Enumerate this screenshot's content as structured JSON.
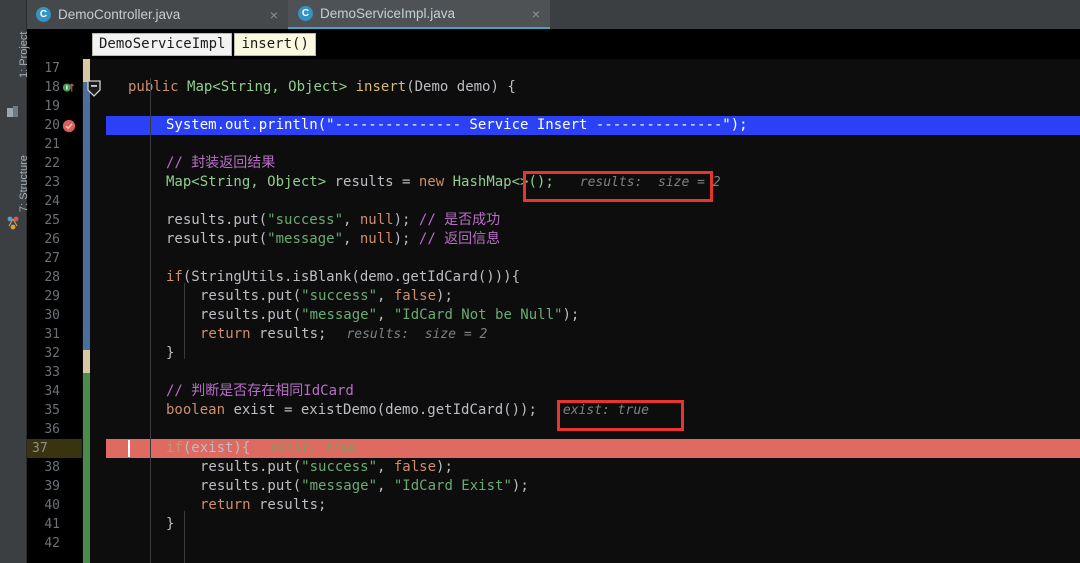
{
  "sidebar": {
    "items": [
      {
        "label": "1: Project",
        "icon": "project-icon"
      },
      {
        "label": "7: Structure",
        "icon": "structure-icon"
      }
    ]
  },
  "tabs": [
    {
      "label": "DemoController.java",
      "icon": "java-class-icon",
      "close": "×",
      "active": false
    },
    {
      "label": "DemoServiceImpl.java",
      "icon": "java-class-icon",
      "close": "×",
      "active": true
    }
  ],
  "breadcrumb": {
    "class_chip": "DemoServiceImpl",
    "method_chip": "insert()"
  },
  "editor": {
    "first_line": 17,
    "last_line": 42,
    "line_numbers": [
      "17",
      "18",
      "19",
      "20",
      "21",
      "22",
      "23",
      "24",
      "25",
      "26",
      "27",
      "28",
      "29",
      "30",
      "31",
      "32",
      "33",
      "34",
      "35",
      "36",
      "37",
      "38",
      "39",
      "40",
      "41",
      "42"
    ],
    "gutter_icons": [
      {
        "line": 18,
        "name": "implementing-method-icon"
      },
      {
        "line": 20,
        "name": "breakpoint-verified-icon"
      }
    ],
    "execution_line": 37,
    "selected_line": 20,
    "code": {
      "l18_kw": "public",
      "l18_type": "Map<String, Object>",
      "l18_fn": "insert",
      "l18_params": "(Demo demo) {",
      "l20_text": "System.out.println(\"--------------- Service Insert ---------------\");",
      "l22_comment": "// 封装返回结果",
      "l23_type": "Map<String, Object>",
      "l23_var": " results = ",
      "l23_new": "new",
      "l23_rest": " HashMap<>();",
      "l25_a": "results.put(",
      "l25_str": "\"success\"",
      "l25_b": ", ",
      "l25_null": "null",
      "l25_c": ");",
      "l25_comment": "// 是否成功",
      "l26_a": "results.put(",
      "l26_str": "\"message\"",
      "l26_b": ", ",
      "l26_null": "null",
      "l26_c": ");",
      "l26_comment": "// 返回信息",
      "l28_if": "if",
      "l28_rest": "(StringUtils.isBlank(demo.getIdCard())){",
      "l29_a": "results.put(",
      "l29_str": "\"success\"",
      "l29_b": ", ",
      "l29_kw": "false",
      "l29_c": ");",
      "l30_a": "results.put(",
      "l30_str1": "\"message\"",
      "l30_b": ", ",
      "l30_str2": "\"IdCard Not be Null\"",
      "l30_c": ");",
      "l31_kw": "return",
      "l31_rest": " results;",
      "l32_brace": "}",
      "l34_comment": "// 判断是否存在相同IdCard",
      "l35_kw": "boolean",
      "l35_rest": " exist = existDemo(demo.getIdCard());",
      "l37_if": "if",
      "l37_rest": "(exist){",
      "l38_a": "results.put(",
      "l38_str": "\"success\"",
      "l38_b": ", ",
      "l38_kw": "false",
      "l38_c": ");",
      "l39_a": "results.put(",
      "l39_str1": "\"message\"",
      "l39_b": ", ",
      "l39_str2": "\"IdCard Exist\"",
      "l39_c": ");",
      "l40_kw": "return",
      "l40_rest": " results;",
      "l41_brace": "}"
    },
    "inline_hints": [
      {
        "line": 23,
        "text": "results:  size = 2",
        "boxed": true
      },
      {
        "line": 31,
        "text": "results:  size = 2",
        "boxed": false
      },
      {
        "line": 35,
        "text": "exist: true",
        "boxed": true
      },
      {
        "line": 37,
        "text": "exist: true",
        "boxed": false
      }
    ],
    "change_stripe": [
      {
        "color": "#d9c9a3",
        "from_line": 17,
        "to_line": 17
      },
      {
        "color": "#4a6f9e",
        "from_line": 18,
        "to_line": 31
      },
      {
        "color": "#d9c9a3",
        "from_line": 32,
        "to_line": 32
      },
      {
        "color": "#4a8d4a",
        "from_line": 33,
        "to_line": 42
      }
    ]
  },
  "colors": {
    "editor_bg": "#0d0d0d",
    "selected_line_bg": "#2b41f5",
    "execution_line_bg": "#de6a62",
    "hint_box_border": "#e8342c",
    "accent_tab_underline": "#3ca6c4",
    "keyword": "#cf8e6d",
    "string": "#6aab73",
    "comment": "#b86ec6",
    "type": "#8fce8f",
    "method": "#d9b974"
  }
}
